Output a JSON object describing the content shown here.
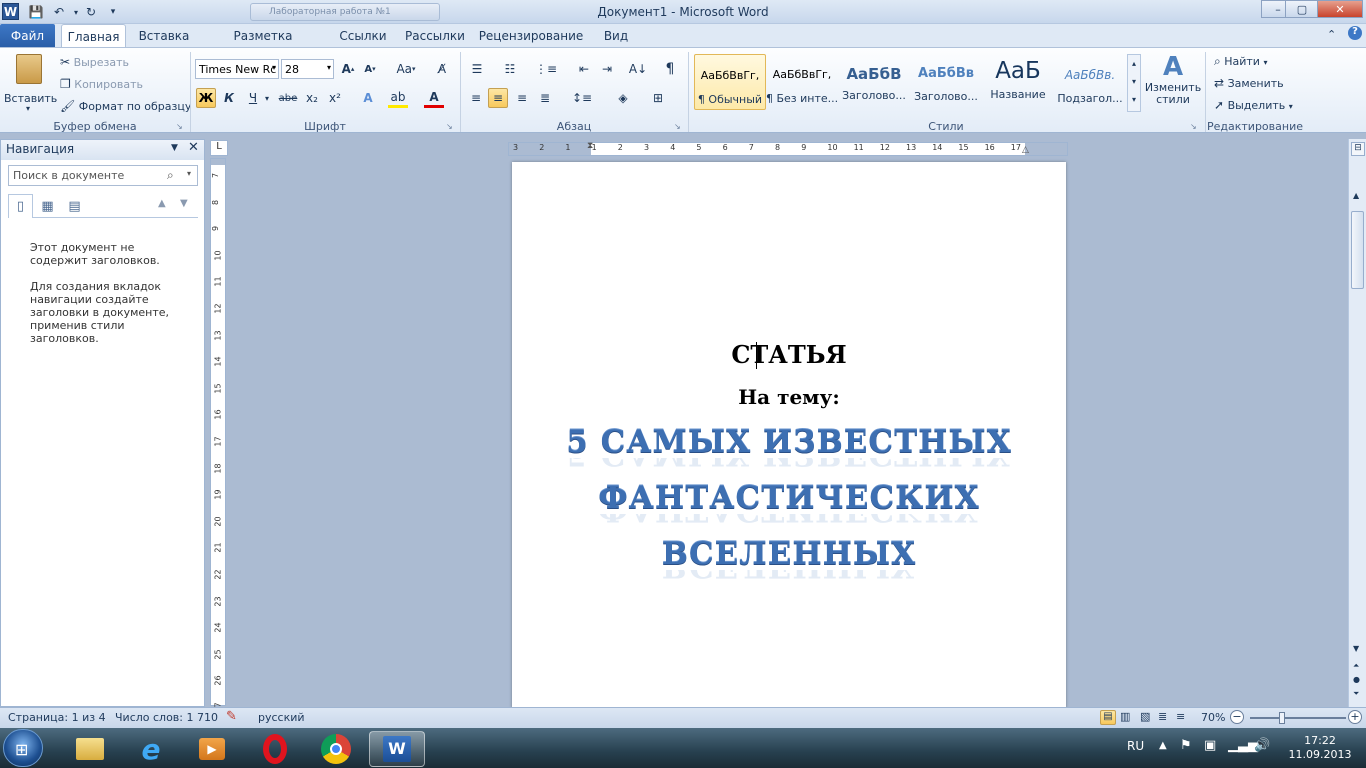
{
  "window": {
    "title": "Документ1 - Microsoft Word",
    "background_tab_title": "Лабораторная работа №1",
    "controls": [
      "–",
      "▢",
      "✕"
    ]
  },
  "tabs": {
    "file": "Файл",
    "items": [
      "Главная",
      "Вставка",
      "Разметка страницы",
      "Ссылки",
      "Рассылки",
      "Рецензирование",
      "Вид"
    ]
  },
  "clipboard": {
    "paste": "Вставить",
    "cut": "Вырезать",
    "copy": "Копировать",
    "format_painter": "Формат по образцу",
    "label": "Буфер обмена"
  },
  "font": {
    "name": "Times New Rc",
    "size": "28",
    "bold": "Ж",
    "italic": "К",
    "underline": "Ч",
    "strike": "abe",
    "label": "Шрифт"
  },
  "paragraph": {
    "label": "Абзац"
  },
  "styles": {
    "label": "Стили",
    "items": [
      {
        "sample": "АаБбВвГг,",
        "name": "¶ Обычный"
      },
      {
        "sample": "АаБбВвГг,",
        "name": "¶ Без инте..."
      },
      {
        "sample": "АаБбВ",
        "name": "Заголово..."
      },
      {
        "sample": "АаБбВв",
        "name": "Заголово..."
      },
      {
        "sample": "АаБ",
        "name": "Название"
      },
      {
        "sample": "АаБбВв.",
        "name": "Подзагол..."
      }
    ],
    "change": "Изменить стили"
  },
  "editing": {
    "find": "Найти",
    "replace": "Заменить",
    "select": "Выделить",
    "label": "Редактирование"
  },
  "navigation": {
    "title": "Навигация",
    "search_placeholder": "Поиск в документе",
    "msg1": "Этот документ не содержит заголовков.",
    "msg2": "Для создания вкладок навигации создайте заголовки в документе, применив стили заголовков."
  },
  "ruler": {
    "h_ticks": [
      "3",
      "2",
      "1",
      "1",
      "2",
      "3",
      "4",
      "5",
      "6",
      "7",
      "8",
      "9",
      "10",
      "11",
      "12",
      "13",
      "14",
      "15",
      "16",
      "17"
    ],
    "v_ticks": [
      "7",
      "8",
      "9",
      "10",
      "11",
      "12",
      "13",
      "14",
      "15",
      "16",
      "17",
      "18",
      "19",
      "20",
      "21",
      "22",
      "23",
      "24",
      "25",
      "26",
      "27"
    ]
  },
  "document": {
    "title": "СТАТЬЯ",
    "subtitle": "На тему:",
    "art_lines": [
      "5 САМЫХ ИЗВЕСТНЫХ",
      "ФАНТАСТИЧЕСКИХ",
      "ВСЕЛЕННЫХ"
    ]
  },
  "status": {
    "page": "Страница: 1 из 4",
    "words": "Число слов: 1 710",
    "lang": "русский",
    "zoom": "70%"
  },
  "taskbar": {
    "lang": "RU",
    "time": "17:22",
    "date": "11.09.2013"
  },
  "colors": {
    "ribbon_accent": "#2a5ea8",
    "wordart": "#3d6fb2"
  }
}
